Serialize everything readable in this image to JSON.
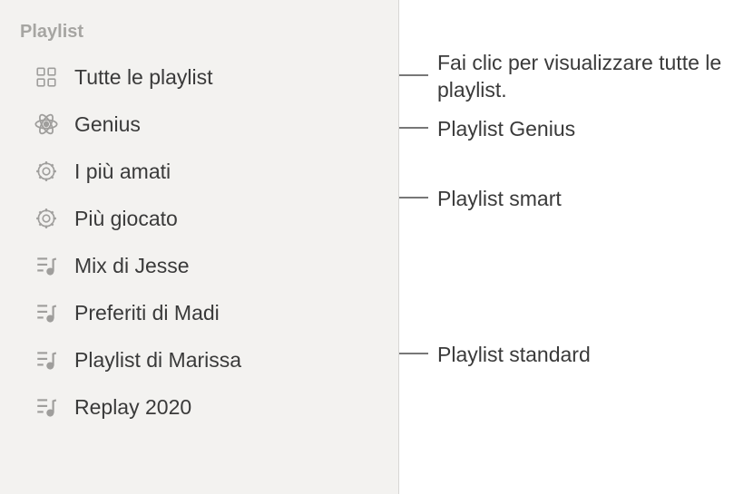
{
  "sidebar": {
    "header": "Playlist",
    "items": [
      {
        "label": "Tutte le playlist",
        "icon": "grid-icon"
      },
      {
        "label": "Genius",
        "icon": "atom-icon"
      },
      {
        "label": "I più amati",
        "icon": "gear-icon"
      },
      {
        "label": "Più giocato",
        "icon": "gear-icon"
      },
      {
        "label": "Mix di Jesse",
        "icon": "music-list-icon"
      },
      {
        "label": "Preferiti di Madi",
        "icon": "music-list-icon"
      },
      {
        "label": "Playlist di Marissa",
        "icon": "music-list-icon"
      },
      {
        "label": "Replay 2020",
        "icon": "music-list-icon"
      }
    ]
  },
  "annotations": {
    "all": "Fai clic per visualizzare tutte le playlist.",
    "genius": "Playlist Genius",
    "smart": "Playlist smart",
    "standard": "Playlist standard"
  }
}
